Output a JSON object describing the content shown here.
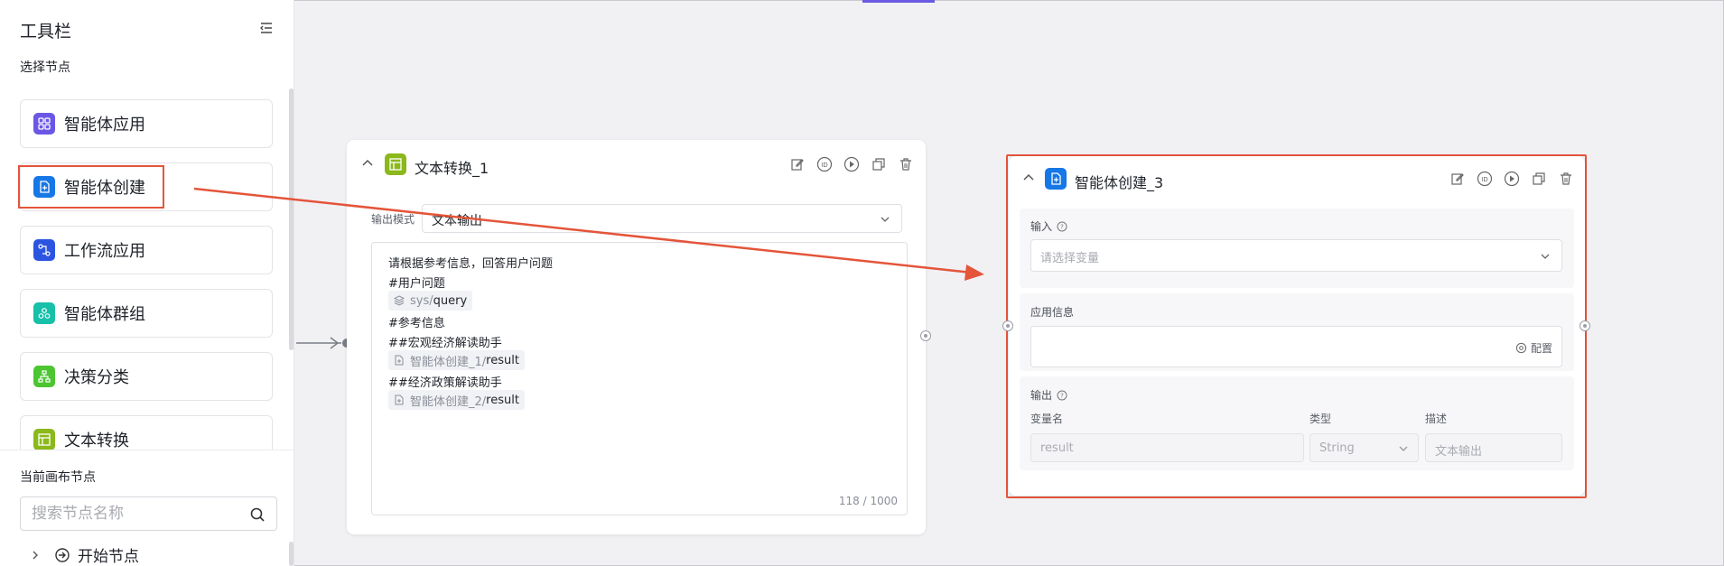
{
  "sidebar": {
    "title": "工具栏",
    "collapse_icon": "collapse-menu-icon",
    "select_nodes_label": "选择节点",
    "items": [
      {
        "label": "智能体应用",
        "icon": "grid-apps-icon",
        "color": "#6b57e6"
      },
      {
        "label": "智能体创建",
        "icon": "plus-doc-icon",
        "color": "#1677e6"
      },
      {
        "label": "工作流应用",
        "icon": "workflow-icon",
        "color": "#2b55e0"
      },
      {
        "label": "智能体群组",
        "icon": "group-icon",
        "color": "#17c0a8"
      },
      {
        "label": "决策分类",
        "icon": "tree-icon",
        "color": "#4cc531"
      },
      {
        "label": "文本转换",
        "icon": "layout-icon",
        "color": "#8bb81a"
      }
    ],
    "canvas_nodes_title": "当前画布节点",
    "search_placeholder": "搜索节点名称",
    "start_node_label": "开始节点"
  },
  "text_node": {
    "title": "文本转换_1",
    "output_mode_label": "输出模式",
    "output_mode_value": "文本输出",
    "lines": {
      "l1": "请根据参考信息，回答用户问题",
      "l2": "#用户问题",
      "chip1_prefix": "sys/",
      "chip1_name": "query",
      "l3": "#参考信息",
      "l4": "##宏观经济解读助手",
      "chip2_prefix": "智能体创建_1/",
      "chip2_name": "result",
      "l5": "##经济政策解读助手",
      "chip3_prefix": "智能体创建_2/",
      "chip3_name": "result"
    },
    "counter": "118 / 1000"
  },
  "agent_node": {
    "title": "智能体创建_3",
    "input_label": "输入",
    "input_placeholder": "请选择变量",
    "app_info_label": "应用信息",
    "config_label": "配置",
    "output_label": "输出",
    "col_var": "变量名",
    "col_type": "类型",
    "col_desc": "描述",
    "var_value": "result",
    "type_value": "String",
    "desc_value": "文本输出"
  },
  "colors": {
    "highlight": "#e4553a",
    "accent": "#6a5ae0"
  }
}
